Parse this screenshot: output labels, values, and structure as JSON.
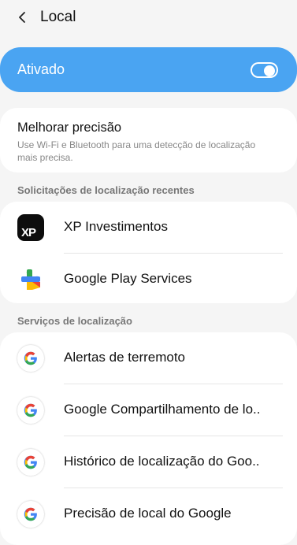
{
  "header": {
    "title": "Local",
    "back_icon": "chevron-left-icon"
  },
  "master_switch": {
    "label": "Ativado",
    "state": "on",
    "color": "#4aa4f2"
  },
  "precision": {
    "title": "Melhorar precisão",
    "description": "Use Wi-Fi e Bluetooth para uma detecção de localização mais precisa."
  },
  "recent": {
    "header": "Solicitações de localização recentes",
    "items": [
      {
        "label": "XP Investimentos",
        "icon": "xp-investimentos-icon"
      },
      {
        "label": "Google Play Services",
        "icon": "google-play-services-icon"
      }
    ]
  },
  "services": {
    "header": "Serviços de localização",
    "items": [
      {
        "label": "Alertas de terremoto",
        "icon": "google-g-icon"
      },
      {
        "label": "Google Compartilhamento de lo..",
        "icon": "google-g-icon"
      },
      {
        "label": "Histórico de localização do Goo..",
        "icon": "google-g-icon"
      },
      {
        "label": "Precisão de local do Google",
        "icon": "google-g-icon"
      }
    ]
  }
}
